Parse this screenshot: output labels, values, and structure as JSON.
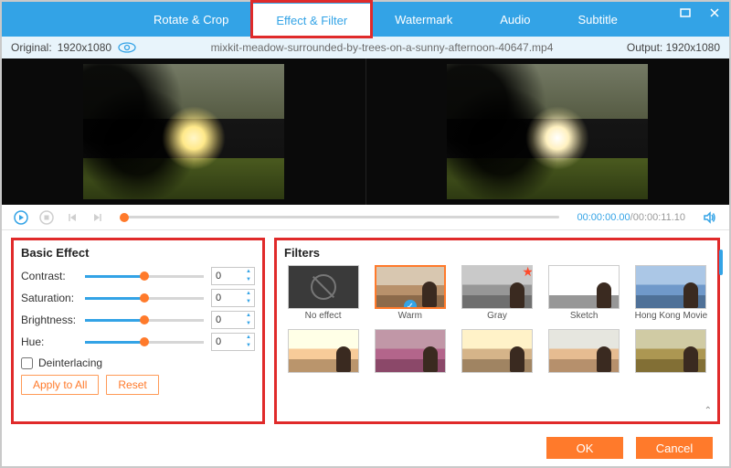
{
  "tabs": {
    "rotate": "Rotate & Crop",
    "effect": "Effect & Filter",
    "watermark": "Watermark",
    "audio": "Audio",
    "subtitle": "Subtitle"
  },
  "info": {
    "original_label": "Original:",
    "original_res": "1920x1080",
    "filename": "mixkit-meadow-surrounded-by-trees-on-a-sunny-afternoon-40647.mp4",
    "output_label": "Output:",
    "output_res": "1920x1080"
  },
  "playback": {
    "current": "00:00:00.00",
    "total": "00:00:11.10"
  },
  "basic": {
    "title": "Basic Effect",
    "contrast_label": "Contrast:",
    "contrast_value": "0",
    "saturation_label": "Saturation:",
    "saturation_value": "0",
    "brightness_label": "Brightness:",
    "brightness_value": "0",
    "hue_label": "Hue:",
    "hue_value": "0",
    "deinterlacing_label": "Deinterlacing",
    "apply_label": "Apply to All",
    "reset_label": "Reset"
  },
  "filters": {
    "title": "Filters",
    "items": {
      "none": "No effect",
      "warm": "Warm",
      "gray": "Gray",
      "sketch": "Sketch",
      "hk": "Hong Kong Movie"
    }
  },
  "footer": {
    "ok": "OK",
    "cancel": "Cancel"
  },
  "colors": {
    "accent": "#33a3e6",
    "primary_btn": "#ff7a2b",
    "highlight": "#e02a2a"
  }
}
